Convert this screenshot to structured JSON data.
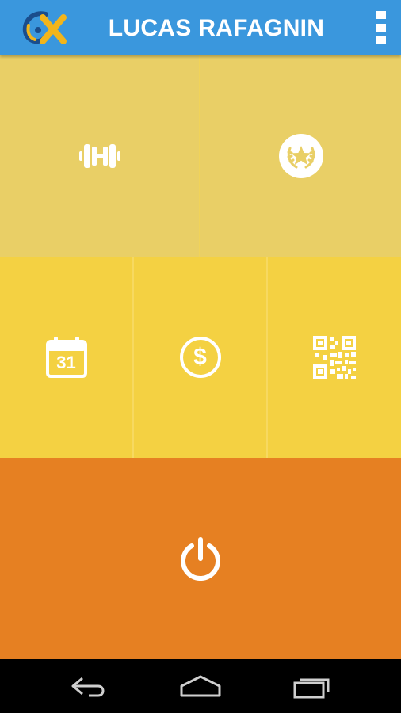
{
  "app_bar": {
    "title": "LUCAS RAFAGNIN",
    "logo_icon": "brand-logo",
    "menu_icon": "overflow-menu-icon",
    "background": "#3a97dd"
  },
  "tiles": [
    {
      "name": "workout",
      "icon": "dumbbell-icon",
      "color": "#e9cf66"
    },
    {
      "name": "achievements",
      "icon": "laurel-star-badge-icon",
      "color": "#e9cf66"
    },
    {
      "name": "calendar",
      "icon": "calendar-icon",
      "color": "#f4d142",
      "calendar_day": "31"
    },
    {
      "name": "payments",
      "icon": "dollar-icon",
      "color": "#f4d142",
      "dollar_glyph": "$"
    },
    {
      "name": "qr-code",
      "icon": "qr-code-icon",
      "color": "#f4d142"
    },
    {
      "name": "logout",
      "icon": "power-icon",
      "color": "#e68022"
    }
  ],
  "nav_bar": {
    "back_icon": "back-icon",
    "home_icon": "home-icon",
    "recents_icon": "recent-apps-icon"
  }
}
